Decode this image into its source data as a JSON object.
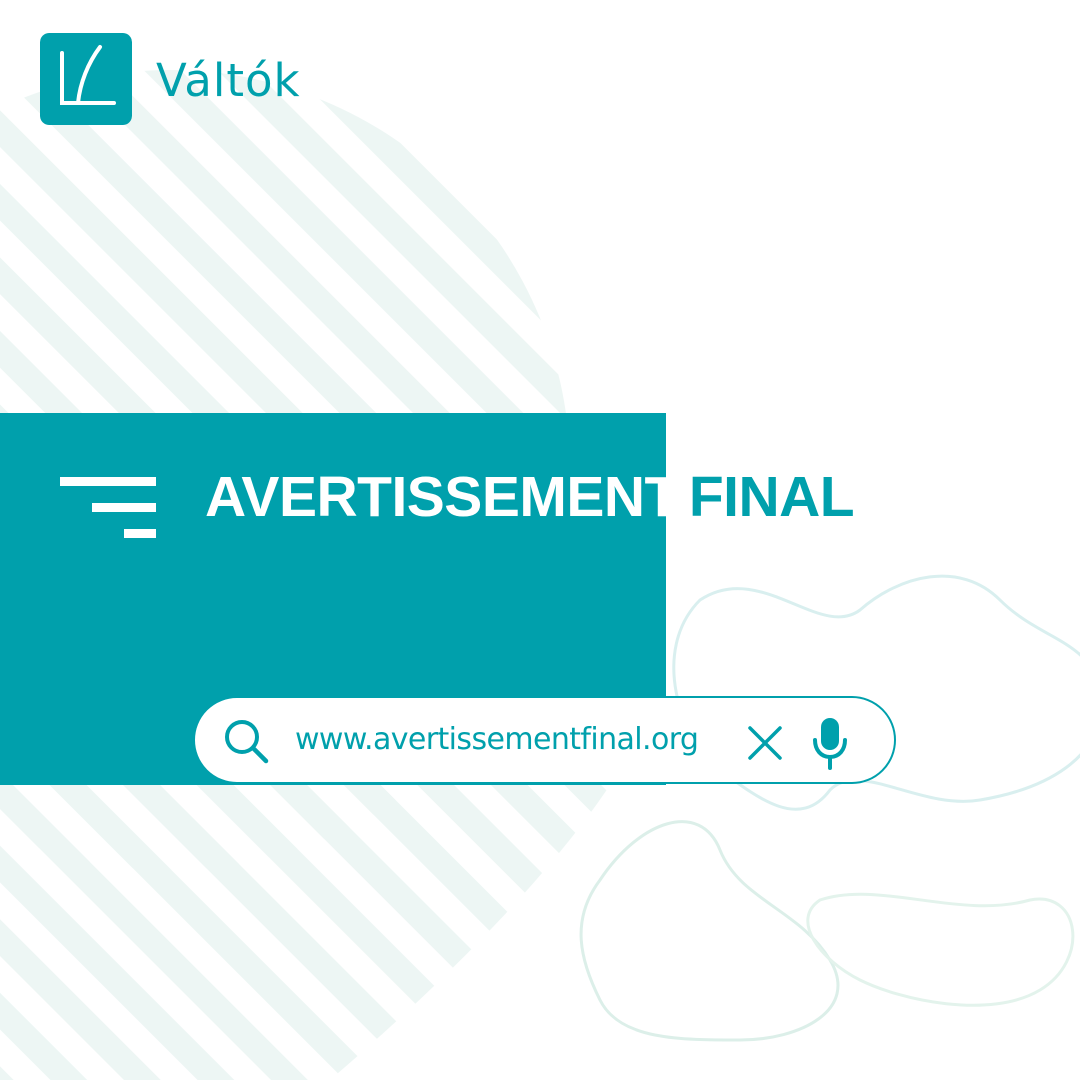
{
  "colors": {
    "brand": "#00A0AC",
    "background": "#ffffff",
    "stripe": "#EDF6F4",
    "stripe_alt": "#F1F9EF",
    "blob_line": "#D5EEEC",
    "on_brand_text": "#ffffff"
  },
  "logo": {
    "mark_icon": "vl-monogram-icon",
    "text": "Váltók"
  },
  "banner": {
    "menu_icon": "filter-lines-icon",
    "headline_word_1": "AVERTISSEMENT",
    "headline_word_2": "FINAL"
  },
  "search": {
    "icon": "search-icon",
    "value": "www.avertissementfinal.org",
    "clear_icon": "close-icon",
    "voice_icon": "microphone-icon"
  }
}
